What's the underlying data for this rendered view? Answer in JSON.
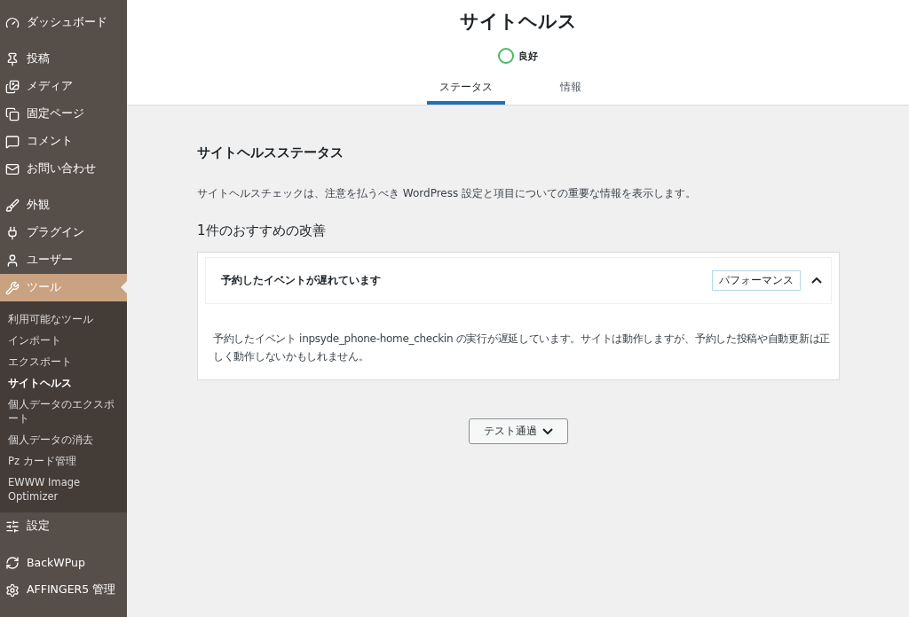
{
  "sidebar": {
    "groups": [
      [
        {
          "label": "ダッシュボード",
          "selected": false
        }
      ],
      [
        {
          "label": "投稿",
          "selected": false
        },
        {
          "label": "メディア",
          "selected": false
        },
        {
          "label": "固定ページ",
          "selected": false
        },
        {
          "label": "コメント",
          "selected": false
        },
        {
          "label": "お問い合わせ",
          "selected": false
        }
      ],
      [
        {
          "label": "外観",
          "selected": false
        },
        {
          "label": "プラグイン",
          "selected": false
        },
        {
          "label": "ユーザー",
          "selected": false
        },
        {
          "label": "ツール",
          "selected": true,
          "children": [
            {
              "label": "利用可能なツール",
              "selected": false
            },
            {
              "label": "インポート",
              "selected": false
            },
            {
              "label": "エクスポート",
              "selected": false
            },
            {
              "label": "サイトヘルス",
              "selected": true
            },
            {
              "label": "個人データのエクスポート",
              "selected": false
            },
            {
              "label": "個人データの消去",
              "selected": false
            },
            {
              "label": "Pz カード管理",
              "selected": false
            },
            {
              "label": "EWWW Image Optimizer",
              "selected": false
            }
          ]
        },
        {
          "label": "設定",
          "selected": false
        }
      ],
      [
        {
          "label": "BackWPup",
          "selected": false
        },
        {
          "label": "AFFINGER5 管理",
          "selected": false
        }
      ]
    ]
  },
  "header": {
    "title": "サイトヘルス",
    "status": "良好",
    "tabs": [
      {
        "label": "ステータス",
        "selected": true
      },
      {
        "label": "情報",
        "selected": false
      }
    ]
  },
  "content": {
    "heading": "サイトヘルスステータス",
    "description": "サイトヘルスチェックは、注意を払うべき WordPress 設定と項目についての重要な情報を表示します。",
    "count_heading": "1件のおすすめの改善",
    "issues": [
      {
        "title": "予約したイベントが遅れています",
        "badge": "パフォーマンス",
        "expanded": true,
        "body": "予約したイベント inpsyde_phone-home_checkin の実行が遅延しています。サイトは動作しますが、予約した投稿や自動更新は正しく動作しないかもしれません。"
      }
    ],
    "passed_button": "テスト通過"
  }
}
